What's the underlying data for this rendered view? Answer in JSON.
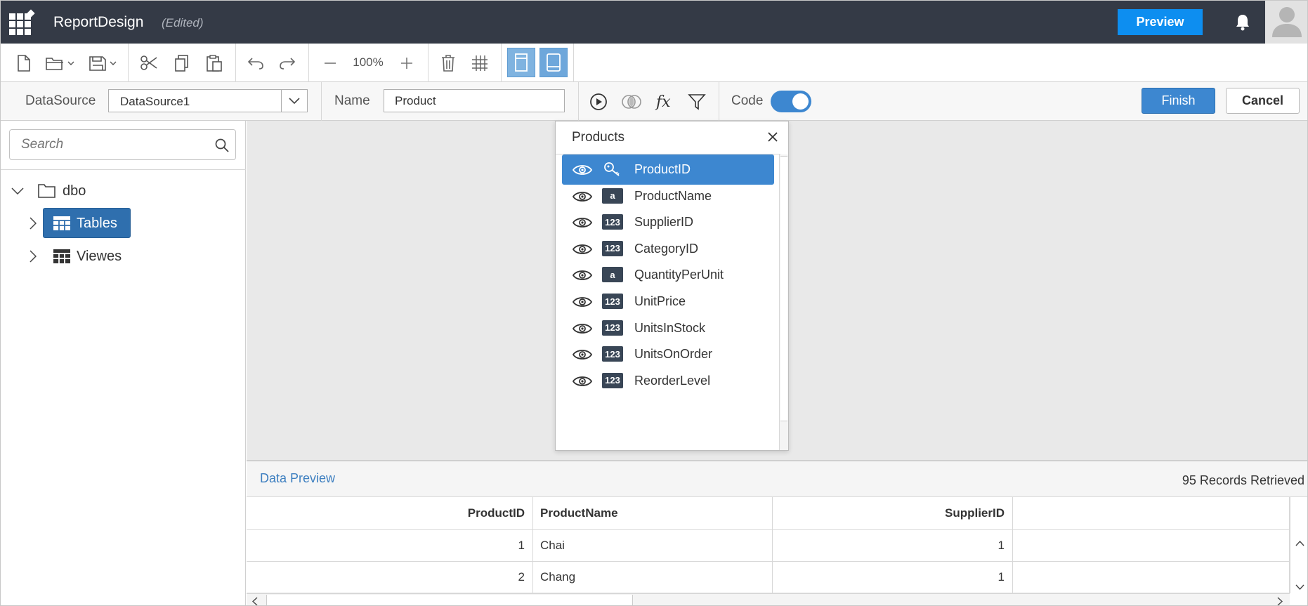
{
  "header": {
    "app_title": "ReportDesign",
    "status": "(Edited)",
    "preview_label": "Preview"
  },
  "toolbar": {
    "zoom": "100%"
  },
  "props": {
    "datasource_label": "DataSource",
    "datasource_value": "DataSource1",
    "name_label": "Name",
    "name_value": "Product",
    "code_label": "Code",
    "code_enabled": true,
    "finish_label": "Finish",
    "cancel_label": "Cancel"
  },
  "left_panel": {
    "search_placeholder": "Search",
    "tree": {
      "root": "dbo",
      "children": [
        "Tables",
        "Viewes"
      ],
      "selected": "Tables"
    }
  },
  "products_popup": {
    "title": "Products",
    "selected": "ProductID",
    "fields": [
      {
        "name": "ProductID",
        "type": "key"
      },
      {
        "name": "ProductName",
        "type": "a"
      },
      {
        "name": "SupplierID",
        "type": "123"
      },
      {
        "name": "CategoryID",
        "type": "123"
      },
      {
        "name": "QuantityPerUnit",
        "type": "a"
      },
      {
        "name": "UnitPrice",
        "type": "123"
      },
      {
        "name": "UnitsInStock",
        "type": "123"
      },
      {
        "name": "UnitsOnOrder",
        "type": "123"
      },
      {
        "name": "ReorderLevel",
        "type": "123"
      }
    ]
  },
  "data_preview": {
    "title": "Data Preview",
    "records": "95 Records Retrieved",
    "columns": [
      "ProductID",
      "ProductName",
      "SupplierID",
      ""
    ],
    "rows": [
      [
        "1",
        "Chai",
        "1",
        ""
      ],
      [
        "2",
        "Chang",
        "1",
        ""
      ]
    ]
  },
  "colors": {
    "header_bg": "#343a46",
    "accent": "#3d87d0",
    "preview_button": "#0d8ef0",
    "canvas_bg": "#e9e9e9"
  }
}
